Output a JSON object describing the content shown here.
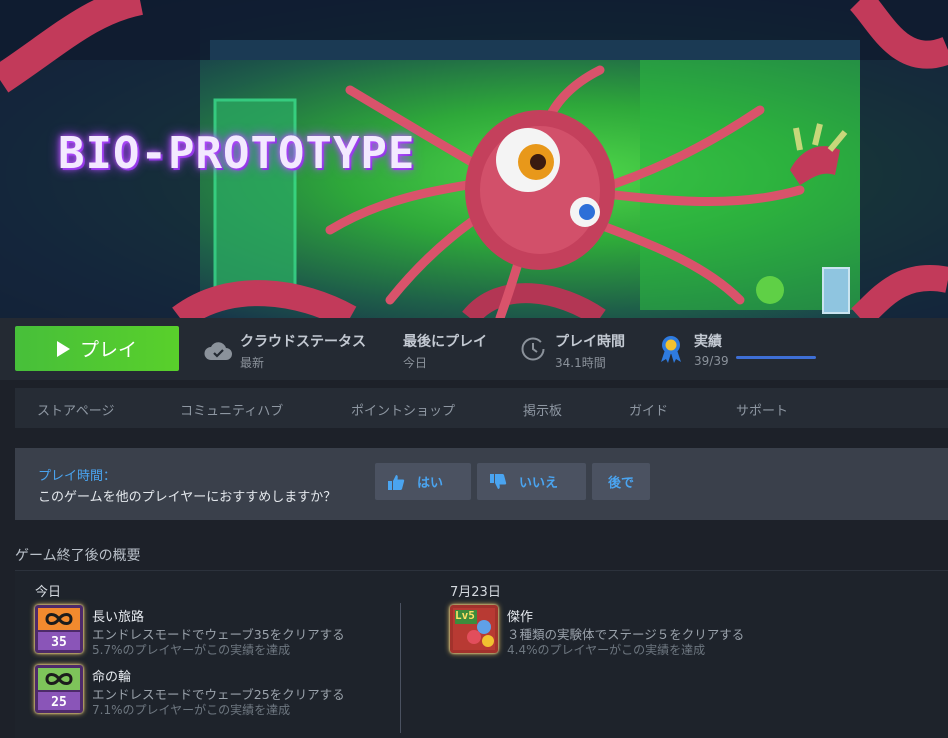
{
  "hero": {
    "logo_text": "BIO-PROTOTYPE"
  },
  "action_bar": {
    "play_label": "プレイ",
    "cloud": {
      "title": "クラウドステータス",
      "value": "最新",
      "icon": "cloud-check-icon"
    },
    "last_played": {
      "title": "最後にプレイ",
      "value": "今日"
    },
    "playtime": {
      "title": "プレイ時間",
      "value": "34.1時間",
      "icon": "clock-icon"
    },
    "achievements": {
      "title": "実績",
      "value": "39/39",
      "progress": 1.0,
      "icon": "ribbon-icon",
      "accent": "#3e6fd6"
    }
  },
  "nav": {
    "items": [
      {
        "label": "ストアページ"
      },
      {
        "label": "コミュニティハブ"
      },
      {
        "label": "ポイントショップ"
      },
      {
        "label": "掲示板"
      },
      {
        "label": "ガイド"
      },
      {
        "label": "サポート"
      }
    ]
  },
  "review": {
    "playtime_label": "プレイ時間：",
    "question": "このゲームを他のプレイヤーにおすすめしますか？",
    "yes_label": "はい",
    "no_label": "いいえ",
    "later_label": "後で"
  },
  "summary": {
    "title": "ゲーム終了後の概要",
    "left": {
      "date": "今日",
      "achievements": [
        {
          "name": "長い旅路",
          "desc": "エンドレスモードでウェーブ35をクリアする",
          "pct": "5.7%のプレイヤーがこの実績を達成",
          "badge": "35"
        },
        {
          "name": "命の輪",
          "desc": "エンドレスモードでウェーブ25をクリアする",
          "pct": "7.1%のプレイヤーがこの実績を達成",
          "badge": "25"
        }
      ]
    },
    "right": {
      "date": "7月23日",
      "achievements": [
        {
          "name": "傑作",
          "desc": "３種類の実験体でステージ５をクリアする",
          "pct": "4.4%のプレイヤーがこの実績を達成",
          "badge": "Lv5"
        }
      ]
    }
  },
  "colors": {
    "play_green": "#59d02b",
    "link_blue": "#4aa4f0"
  }
}
